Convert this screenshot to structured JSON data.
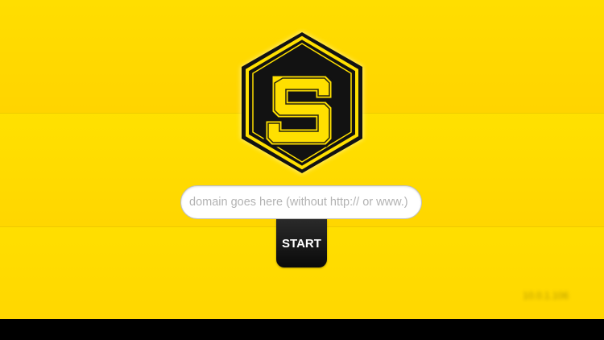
{
  "app": {
    "logo_name": "hexagon-s-logo",
    "colors": {
      "background": "#ffd900",
      "logo_dark": "#111111",
      "logo_yellow": "#ffe000",
      "button": "#111111"
    }
  },
  "domain_field": {
    "value": "",
    "placeholder": "domain goes here (without http:// or www.)"
  },
  "start_button": {
    "label": "START"
  },
  "status": {
    "ip_address": "10.0.1.106"
  }
}
